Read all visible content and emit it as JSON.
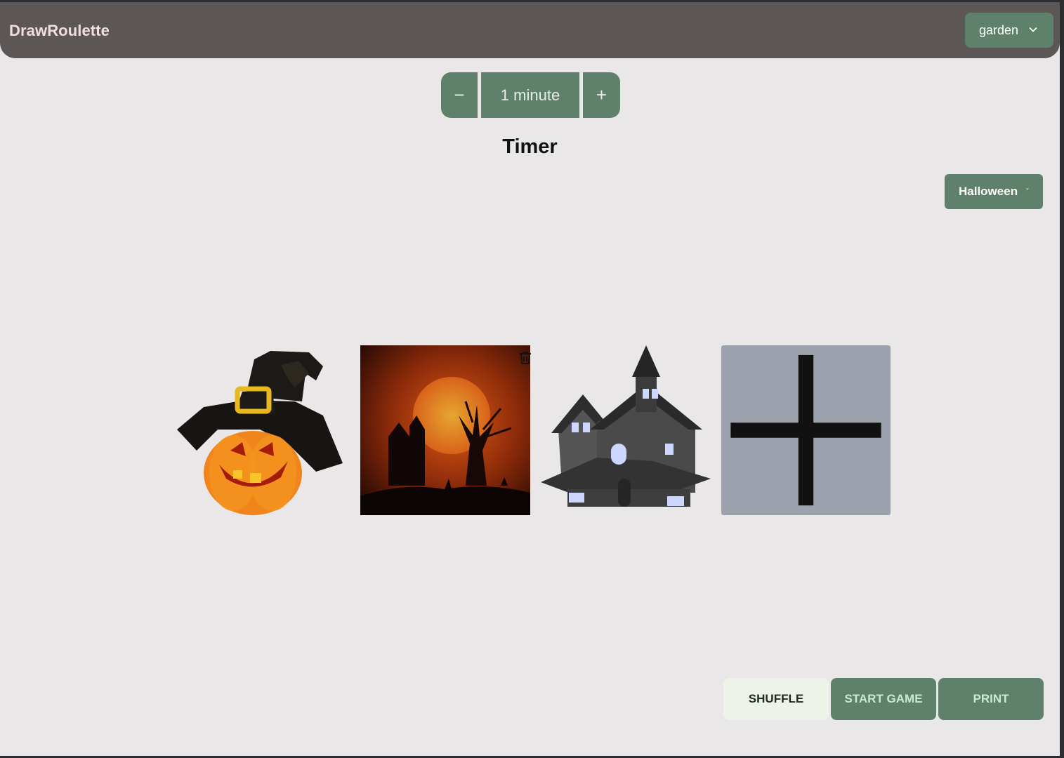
{
  "app": {
    "title": "DrawRoulette"
  },
  "header": {
    "theme_select": {
      "value": "garden",
      "icon": "chevron-down-icon"
    }
  },
  "timer": {
    "decrement_label": "−",
    "value": "1 minute",
    "increment_label": "+",
    "heading": "Timer"
  },
  "category": {
    "value": "Halloween",
    "caret": "ˇ"
  },
  "cards": [
    {
      "name": "jack-o-lantern-witch-hat-image"
    },
    {
      "name": "haunted-house-blood-moon-image"
    },
    {
      "name": "haunted-house-image"
    }
  ],
  "add_card": {
    "icon": "plus-icon"
  },
  "delete_card": {
    "icon": "trash-icon"
  },
  "actions": {
    "shuffle_label": "SHUFFLE",
    "start_label": "START GAME",
    "print_label": "PRINT"
  },
  "colors": {
    "header_bg": "#5d5656",
    "brand_text": "#f3dede",
    "accent_green": "#5f806a",
    "page_bg": "#e9e7e7",
    "add_tile": "#9ca2ad",
    "shuffle_bg": "#eef3ea"
  }
}
